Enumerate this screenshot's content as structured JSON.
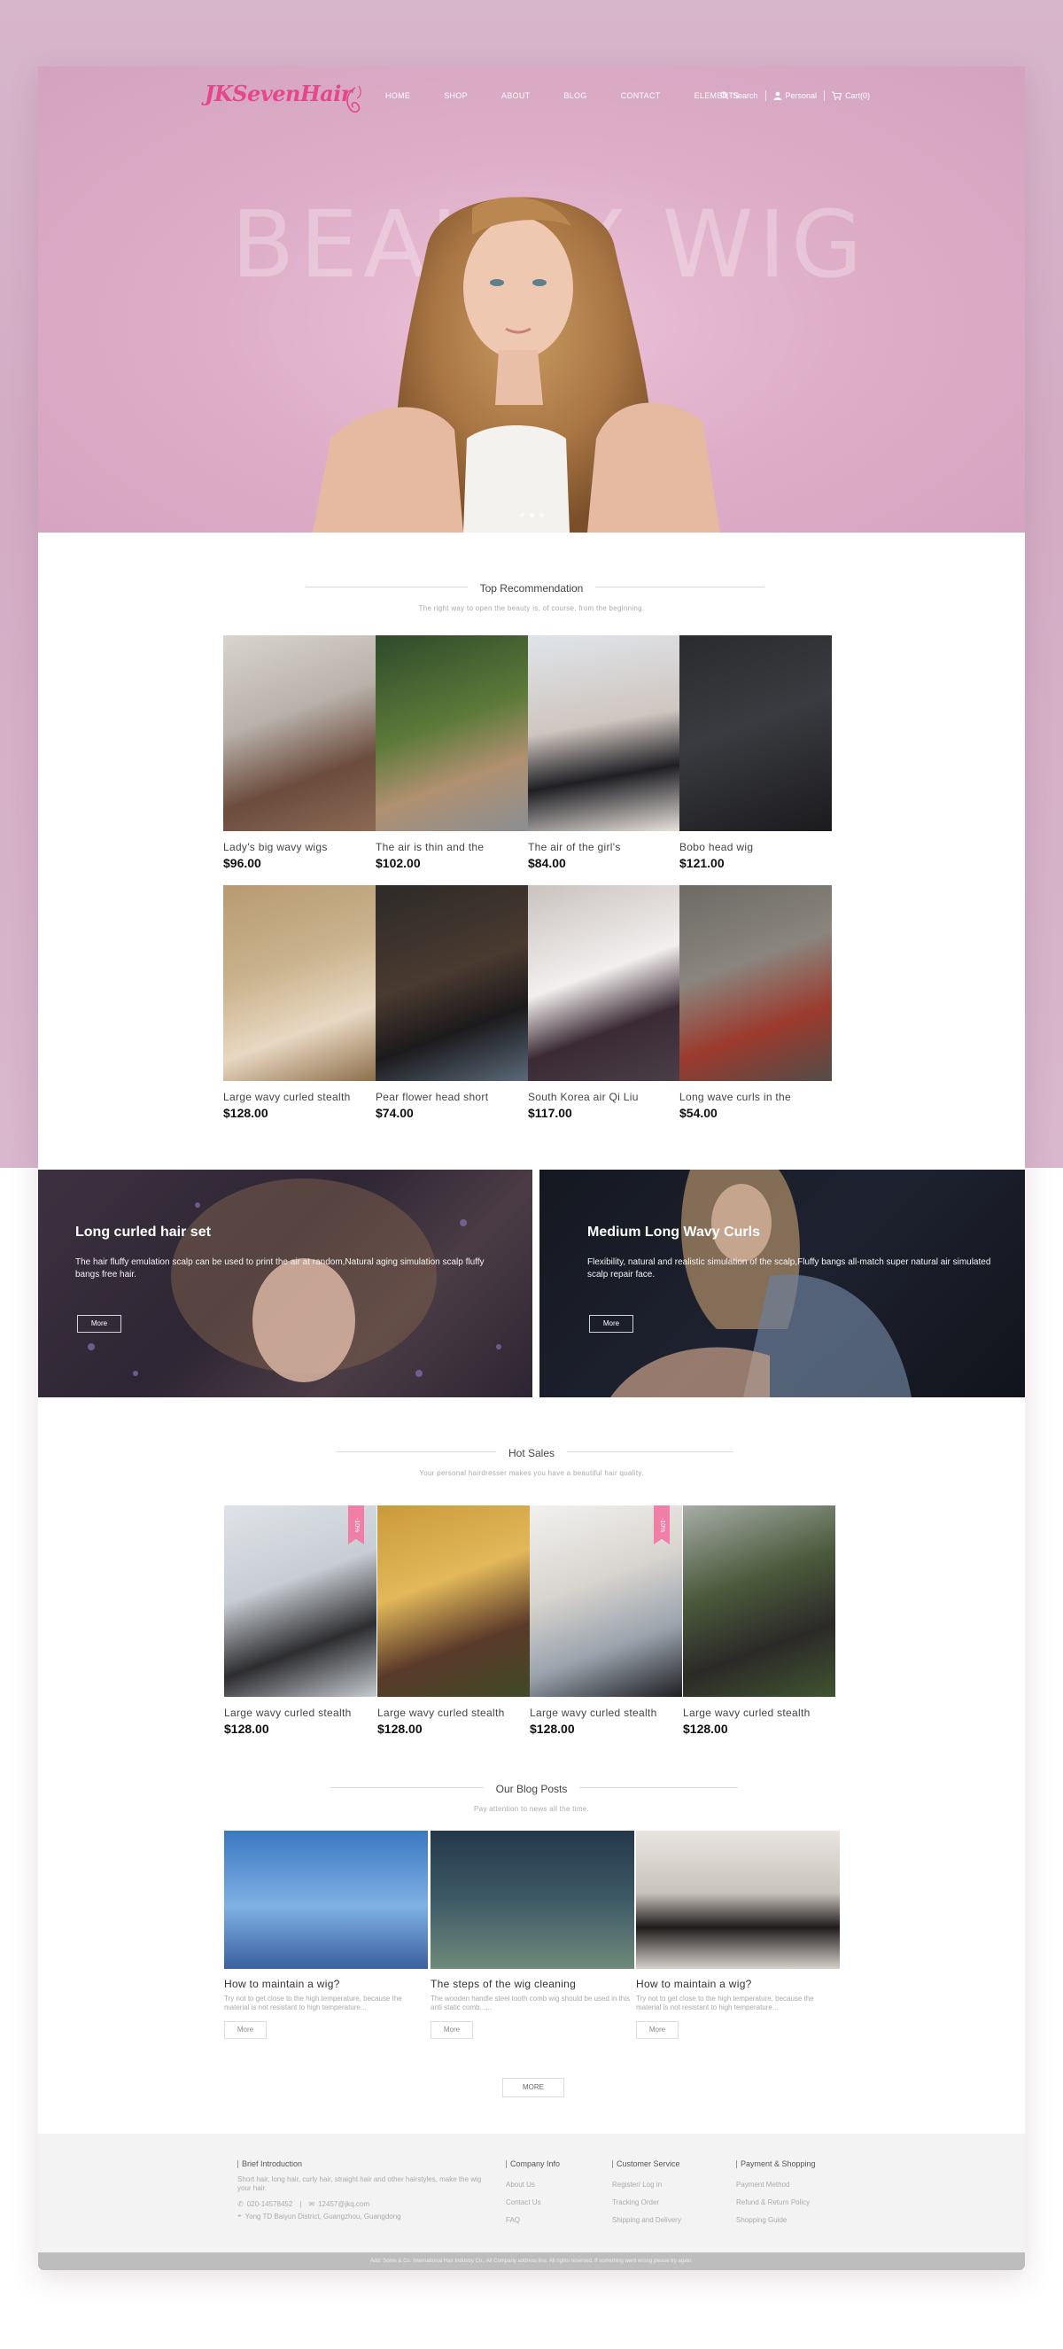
{
  "brand": {
    "name": "JKSevenHair",
    "color": "#e4478b"
  },
  "nav": [
    "HOME",
    "SHOP",
    "ABOUT",
    "BLOG",
    "CONTACT",
    "ELEMENTS"
  ],
  "topbar": {
    "search": "Search",
    "personal": "Personal",
    "cart": "Cart(0)"
  },
  "hero": {
    "word": "BEAUTY WIG",
    "slide_count": 3,
    "active_slide": 1
  },
  "top_recommendation": {
    "title": "Top Recommendation",
    "subtitle": "The right way to open the beauty is, of course, from the beginning.",
    "products": [
      {
        "name": "Lady's big wavy wigs",
        "price": "$96.00"
      },
      {
        "name": "The air is thin and the",
        "price": "$102.00"
      },
      {
        "name": "The air of the girl's",
        "price": "$84.00"
      },
      {
        "name": "Bobo head wig",
        "price": "$121.00"
      },
      {
        "name": "Large wavy curled stealth",
        "price": "$128.00"
      },
      {
        "name": "Pear flower head short",
        "price": "$74.00"
      },
      {
        "name": "South Korea air Qi Liu",
        "price": "$117.00"
      },
      {
        "name": "Long wave curls in the",
        "price": "$54.00"
      }
    ]
  },
  "banners": [
    {
      "title": "Long curled hair set",
      "text": "The hair fluffy emulation scalp can be used to print the air at random,Natural aging simulation scalp fluffy bangs free hair.",
      "button": "More"
    },
    {
      "title": "Medium Long Wavy Curls",
      "text": "Flexibility, natural and realistic simulation of the scalp,Fluffy bangs all-match super natural air simulated scalp repair face.",
      "button": "More"
    }
  ],
  "hot_sales": {
    "title": "Hot Sales",
    "subtitle": "Your personal hairdresser makes you have a beautiful hair quality.",
    "badge": "-10%",
    "products": [
      {
        "name": "Large wavy curled stealth",
        "price": "$128.00",
        "badge": true
      },
      {
        "name": "Large wavy curled stealth",
        "price": "$128.00",
        "badge": false
      },
      {
        "name": "Large wavy curled stealth",
        "price": "$128.00",
        "badge": true
      },
      {
        "name": "Large wavy curled stealth",
        "price": "$128.00",
        "badge": false
      }
    ]
  },
  "blog": {
    "title": "Our Blog Posts",
    "subtitle": "Pay attention to news all the time.",
    "posts": [
      {
        "title": "How to maintain a wig?",
        "desc": "Try not to get close to the high temperature, because the material is not resistant to high temperature...",
        "button": "More"
      },
      {
        "title": "The steps of the wig cleaning",
        "desc": "The wooden handle steel tooth comb wig should be used in this anti static comb......",
        "button": "More"
      },
      {
        "title": "How to maintain a wig?",
        "desc": "Try not to get close to the high temperature, because the material is not resistant to high temperature...",
        "button": "More"
      }
    ],
    "more_button": "MORE"
  },
  "footer": {
    "intro": {
      "title": "Brief Introduction",
      "text": "Short hair, long hair, curly hair, straight hair and other hairstyles, make the wig your hair.",
      "phone": "020-14578452",
      "email": "12457@jkq.com",
      "address": "Yong TD Baiyun District, Guangzhou, Guangdong"
    },
    "company": {
      "title": "Company Info",
      "links": [
        "About Us",
        "Contact Us",
        "FAQ"
      ]
    },
    "service": {
      "title": "Customer Service",
      "links": [
        "Register/ Log in",
        "Tracking Order",
        "Shipping and Delivery"
      ]
    },
    "payment": {
      "title": "Payment & Shopping",
      "links": [
        "Payment Method",
        "Refund & Return Policy",
        "Shopping Guide"
      ]
    },
    "copyright": "Add: Some & Co. International Hair Industry Co., All Company address line. All rights reserved. If something went wrong please try again."
  }
}
